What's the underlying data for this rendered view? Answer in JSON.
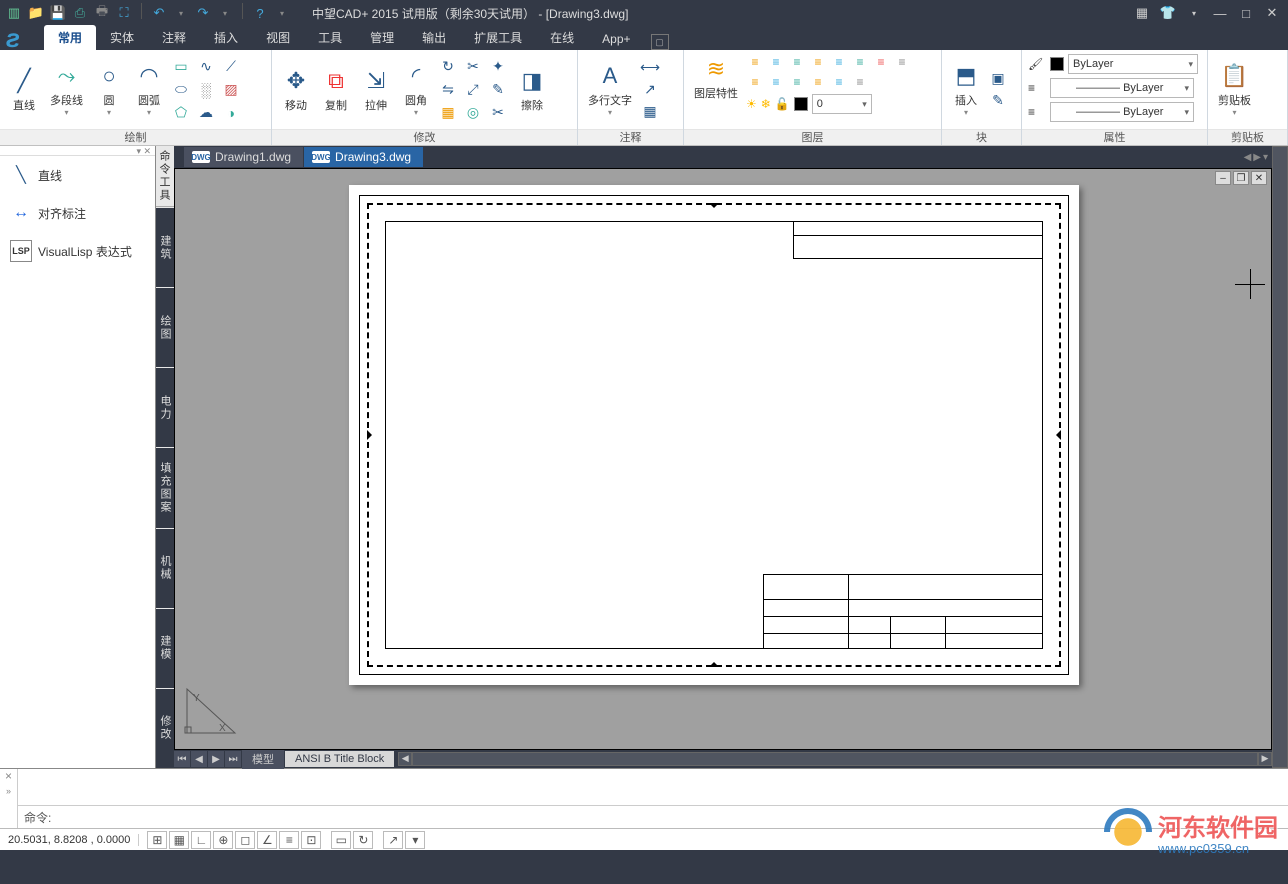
{
  "titlebar": {
    "app_title": "中望CAD+ 2015 试用版（剩余30天试用） - [Drawing3.dwg]"
  },
  "menubar": {
    "tabs": [
      "常用",
      "实体",
      "注释",
      "插入",
      "视图",
      "工具",
      "管理",
      "输出",
      "扩展工具",
      "在线",
      "App+"
    ],
    "active": 0
  },
  "ribbon": {
    "panels": {
      "draw": {
        "label": "绘制",
        "items": [
          "直线",
          "多段线",
          "圆",
          "圆弧"
        ]
      },
      "modify": {
        "label": "修改",
        "items": [
          "移动",
          "复制",
          "拉伸",
          "圆角",
          "擦除"
        ]
      },
      "annotate": {
        "label": "注释",
        "items": [
          "多行文字"
        ]
      },
      "layer": {
        "label": "图层",
        "items": [
          "图层特性"
        ],
        "current": "0"
      },
      "block": {
        "label": "块",
        "items": [
          "插入"
        ]
      },
      "props": {
        "label": "属性",
        "color": "ByLayer",
        "ltype": "ByLayer",
        "lweight": "ByLayer"
      },
      "clip": {
        "label": "剪贴板"
      }
    }
  },
  "leftpane": {
    "items": [
      {
        "icon": "╱",
        "label": "直线"
      },
      {
        "icon": "↔",
        "label": "对齐标注"
      },
      {
        "icon": "LSP",
        "label": "VisualLisp 表达式"
      }
    ]
  },
  "sidetool": {
    "header": "命令工具",
    "groups": [
      "建筑",
      "绘图",
      "电力",
      "填充图案",
      "机械",
      "建模",
      "修改"
    ]
  },
  "doc_tabs": [
    {
      "label": "Drawing1.dwg",
      "active": false
    },
    {
      "label": "Drawing3.dwg",
      "active": true
    }
  ],
  "layout_tabs": {
    "items": [
      "模型",
      "ANSI B Title Block"
    ],
    "active": 1
  },
  "command": {
    "prompt": "命令:"
  },
  "status": {
    "coords": "20.5031, 8.8208 , 0.0000"
  },
  "watermark": {
    "line1": "河东软件园",
    "line2": "www.pc0359.cn"
  }
}
